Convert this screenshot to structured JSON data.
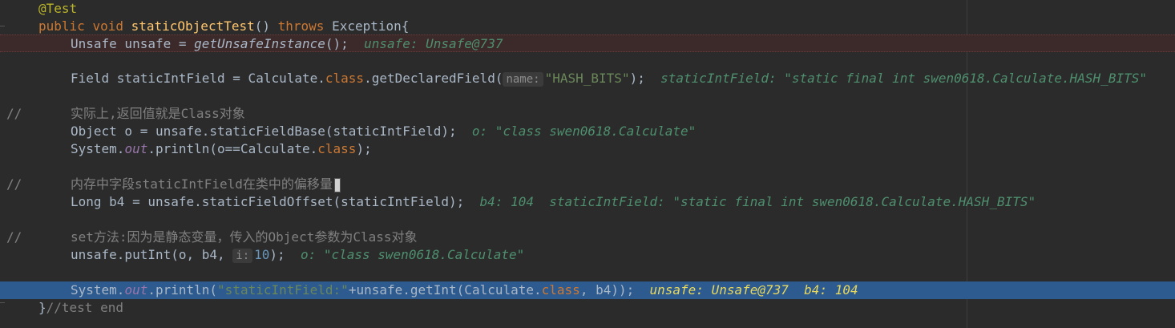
{
  "lines": {
    "l1": {
      "annotation": "@Test"
    },
    "l2": {
      "kw_public": "public",
      "kw_void": "void",
      "method": "staticObjectTest",
      "paren": "() ",
      "kw_throws": "throws",
      "rest": " Exception{"
    },
    "l3": {
      "a": "Unsafe unsafe = ",
      "call": "getUnsafeInstance",
      "b": "();",
      "hint": "unsafe: Unsafe@737"
    },
    "l5": {
      "a": "Field staticIntField = Calculate.",
      "kw_class": "class",
      "b": ".getDeclaredField(",
      "param": "name:",
      "str": "\"HASH_BITS\"",
      "c": ");",
      "hint": "staticIntField: \"static final int swen0618.Calculate.HASH_BITS\""
    },
    "l7": {
      "slashes": "//",
      "comment": "实际上,返回值就是Class对象"
    },
    "l8": {
      "a": "Object o = unsafe.staticFieldBase(staticIntField);",
      "hint": "o: \"class swen0618.Calculate\""
    },
    "l9": {
      "a": "System.",
      "out": "out",
      "b": ".println(o==Calculate.",
      "kw_class": "class",
      "c": ");"
    },
    "l11": {
      "slashes": "//",
      "comment": "内存中字段staticIntField在类中的偏移量"
    },
    "l12": {
      "a": "Long b4 = unsafe.staticFieldOffset(staticIntField);",
      "hint": "b4: 104  staticIntField: \"static final int swen0618.Calculate.HASH_BITS\""
    },
    "l14": {
      "slashes": "//",
      "comment": "set方法:因为是静态变量，传入的Object参数为Class对象"
    },
    "l15": {
      "a": "unsafe.putInt(o, b4, ",
      "param": "i:",
      "num": "10",
      "b": ");",
      "hint": "o: \"class swen0618.Calculate\""
    },
    "l17": {
      "a": "System.",
      "out": "out",
      "b": ".println(",
      "str": "\"staticIntField:\"",
      "c": "+unsafe.getInt(Calculate.",
      "kw_class": "class",
      "d": ", b4));",
      "hint": "unsafe: Unsafe@737  b4: 104"
    },
    "l18": {
      "a": "}",
      "comment": "//test end"
    }
  }
}
